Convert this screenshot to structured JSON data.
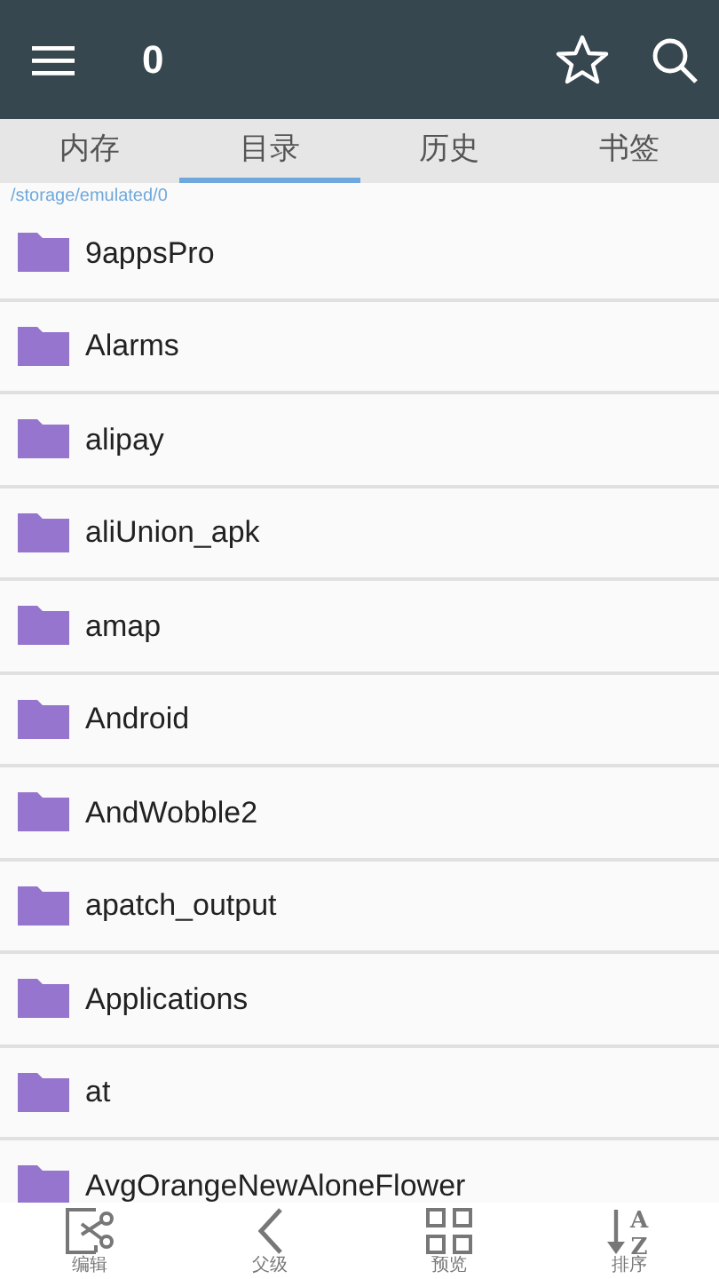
{
  "app_bar": {
    "title": "0"
  },
  "tabs": [
    {
      "label": "内存",
      "selected": false
    },
    {
      "label": "目录",
      "selected": true
    },
    {
      "label": "历史",
      "selected": false
    },
    {
      "label": "书签",
      "selected": false
    }
  ],
  "path": "/storage/emulated/0",
  "folders": [
    {
      "name": "9appsPro"
    },
    {
      "name": "Alarms"
    },
    {
      "name": "alipay"
    },
    {
      "name": "aliUnion_apk"
    },
    {
      "name": "amap"
    },
    {
      "name": "Android"
    },
    {
      "name": "AndWobble2"
    },
    {
      "name": "apatch_output"
    },
    {
      "name": "Applications"
    },
    {
      "name": "at"
    },
    {
      "name": "AvgOrangeNewAloneFlower"
    }
  ],
  "bottom_bar": [
    {
      "kind": "edit",
      "label": "编辑"
    },
    {
      "kind": "parent",
      "label": "父级"
    },
    {
      "kind": "preview",
      "label": "预览"
    },
    {
      "kind": "sort",
      "label": "排序",
      "icon_letters": [
        "A",
        "Z"
      ]
    }
  ]
}
